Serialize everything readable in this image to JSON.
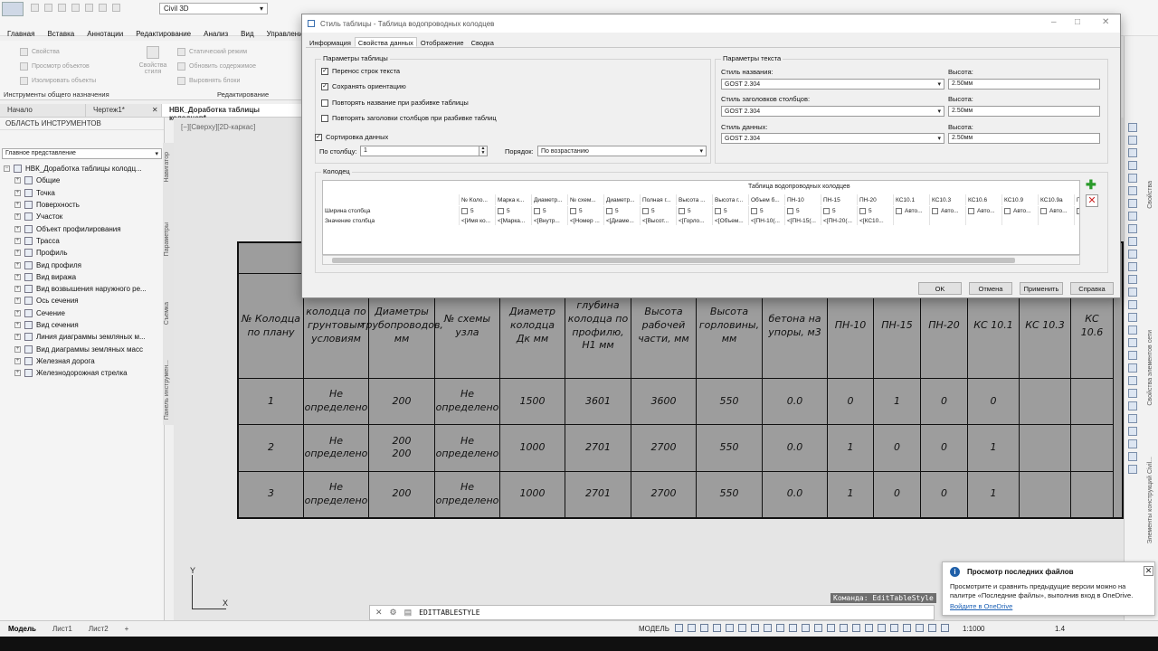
{
  "app": {
    "workspace": "Civil 3D",
    "menu": [
      "Главная",
      "Вставка",
      "Аннотации",
      "Редактирование",
      "Анализ",
      "Вид",
      "Управление"
    ],
    "ribbon": {
      "items_col1": [
        "Свойства",
        "Просмотр объектов",
        "Изолировать объекты"
      ],
      "items_col2": [
        "Свойства стиля"
      ],
      "items_col3": [
        "Статический режим",
        "Обновить содержимое",
        "Выровнять блоки"
      ],
      "panel1": "Инструменты общего назначения",
      "panel2": "Редактирование"
    },
    "doc_tabs": [
      {
        "label": "Начало"
      },
      {
        "label": "Чертеж1*"
      },
      {
        "label": "НВК_Доработка таблицы колодцев*"
      }
    ]
  },
  "toolspace": {
    "title": "ОБЛАСТЬ ИНСТРУМЕНТОВ",
    "view_select": "Главное представление",
    "root": "НВК_Доработка таблицы колодц...",
    "items": [
      "Общие",
      "Точка",
      "Поверхность",
      "Участок",
      "Объект профилирования",
      "Трасса",
      "Профиль",
      "Вид профиля",
      "Вид виража",
      "Вид возвышения наружного ре...",
      "Ось сечения",
      "Сечение",
      "Вид сечения",
      "Линия диаграммы земляных м...",
      "Вид диаграммы земляных масс",
      "Железная дорога",
      "Железнодорожная стрелка"
    ],
    "vtabs": [
      "Навигатор",
      "Параметры",
      "Съемка",
      "Панель инструмен..."
    ]
  },
  "drawing": {
    "view_label": "[−][Сверху][2D-каркас]",
    "axis_y": "Y",
    "axis_x": "X",
    "table_headers": [
      "№ Колодца по плану",
      "колодца по грунтовым условиям",
      "Диаметры трубопроводов, мм",
      "№ схемы узла",
      "Диаметр колодца Дк мм",
      "глубина колодца по профилю, Н1 мм",
      "Высота рабочей части, мм",
      "Высота горловины, мм",
      "бетона на упоры, м3",
      "ПН-10",
      "ПН-15",
      "ПН-20",
      "КС 10.1",
      "КС 10.3",
      "КС 10.6"
    ],
    "rows": [
      [
        "1",
        "Не определено",
        "200",
        "Не определено",
        "1500",
        "3601",
        "3600",
        "550",
        "0.0",
        "0",
        "1",
        "0",
        "0",
        "",
        ""
      ],
      [
        "2",
        "Не определено",
        "200\n200",
        "Не определено",
        "1000",
        "2701",
        "2700",
        "550",
        "0.0",
        "1",
        "0",
        "0",
        "1",
        "",
        ""
      ],
      [
        "3",
        "Не определено",
        "200",
        "Не определено",
        "1000",
        "2701",
        "2700",
        "550",
        "0.0",
        "1",
        "0",
        "0",
        "1",
        "",
        ""
      ]
    ]
  },
  "dialog": {
    "title": "Стиль таблицы - Таблица водопроводных колодцев",
    "tabs": [
      "Информация",
      "Свойства данных",
      "Отображение",
      "Сводка"
    ],
    "table_params": {
      "title": "Параметры таблицы",
      "checks": [
        {
          "label": "Перенос строк текста",
          "checked": true
        },
        {
          "label": "Сохранять ориентацию",
          "checked": true
        },
        {
          "label": "Повторять название при разбивке таблицы",
          "checked": false
        },
        {
          "label": "Повторять заголовки столбцов при разбивке таблиц",
          "checked": false
        }
      ],
      "sort_label": "Сортировка данных",
      "sort_checked": true,
      "by_column_label": "По столбцу:",
      "by_column_value": "1",
      "order_label": "Порядок:",
      "order_value": "По возрастанию"
    },
    "text_params": {
      "title": "Параметры текста",
      "title_style_label": "Стиль названия:",
      "title_style_value": "GOST 2.304",
      "header_style_label": "Стиль заголовков столбцов:",
      "header_style_value": "GOST 2.304",
      "data_style_label": "Стиль данных:",
      "data_style_value": "GOST 2.304",
      "height_label": "Высота:",
      "height_value": "2.50мм"
    },
    "structure": {
      "title": "Колодец",
      "grid_title": "Таблица водопроводных колодцев",
      "col_headers": [
        "№ Коло...",
        "Марка к...",
        "Диаметр...",
        "№ схем...",
        "Диаметр...",
        "Полная г...",
        "Высота ...",
        "Высота г...",
        "Объем б...",
        "ПН-10",
        "ПН-15",
        "ПН-20",
        "КС10.1",
        "КС10.3",
        "КС10.6",
        "КС10.9",
        "КС10.9а",
        "П"
      ],
      "width_label": "Ширина столбца",
      "width_value": "5",
      "value_label": "Значение столбца",
      "value_cells": [
        "<[Имя ко...",
        "<[Марка...",
        "<[Внутр...",
        "<[Номер ...",
        "<[Диаме...",
        "<[Высот...",
        "<[Горло...",
        "<[Объем...",
        "<[ПН-10(...",
        "<[ПН-15(...",
        "<[ПН-20(...",
        "<[КС10...",
        "",
        "",
        "",
        "",
        "",
        ""
      ],
      "auto_label": "Авто..."
    },
    "buttons": {
      "ok": "OK",
      "cancel": "Отмена",
      "apply": "Применить",
      "help": "Справка"
    }
  },
  "command": {
    "tooltip": "Команда: EditTableStyle",
    "text": "EDITTABLESTYLE"
  },
  "layouts": [
    "Модель",
    "Лист1",
    "Лист2"
  ],
  "status": {
    "model": "МОДЕЛЬ",
    "scale": "1:1000",
    "value": "1.4"
  },
  "right_palette": {
    "vtabs": [
      "Свойства",
      "Свойства элементов сети",
      "Элементы конструкций Civil..."
    ]
  },
  "notification": {
    "title": "Просмотр последних файлов",
    "body": "Просмотрите и сравнить предыдущие версии можно на палитре «Последние файлы», выполнив вход в OneDrive.",
    "link": "Войдите в OneDrive"
  }
}
